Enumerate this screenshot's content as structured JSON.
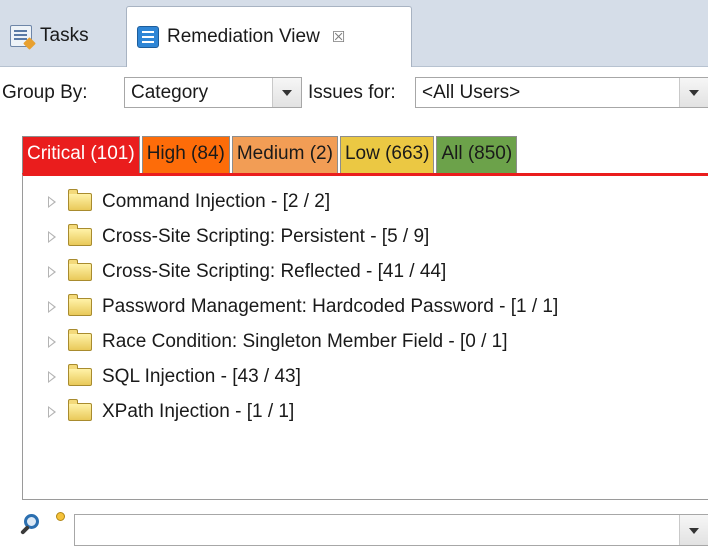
{
  "view_tabs": [
    {
      "label": "Tasks",
      "icon": "tasks-icon"
    },
    {
      "label": "Remediation View",
      "icon": "remediation-view-icon",
      "close_symbol": "☒"
    }
  ],
  "filters": {
    "group_by_label": "Group By:",
    "group_by_value": "Category",
    "issues_for_label": "Issues for:",
    "issues_for_value": "<All Users>"
  },
  "priority_tabs": [
    {
      "label": "Critical (101)",
      "color": "#ea1d1d",
      "selected": true
    },
    {
      "label": "High (84)",
      "color": "#fd6c09"
    },
    {
      "label": "Medium (2)",
      "color": "#f29d55"
    },
    {
      "label": "Low (663)",
      "color": "#ebc843"
    },
    {
      "label": "All (850)",
      "color": "#6ca24a"
    }
  ],
  "categories": [
    "Command Injection - [2 / 2]",
    "Cross-Site Scripting: Persistent - [5 / 9]",
    "Cross-Site Scripting: Reflected - [41 / 44]",
    "Password Management: Hardcoded Password - [1 / 1]",
    "Race Condition: Singleton Member Field - [0 / 1]",
    "SQL Injection - [43 / 43]",
    "XPath Injection - [1 / 1]"
  ],
  "search": {
    "value": ""
  }
}
